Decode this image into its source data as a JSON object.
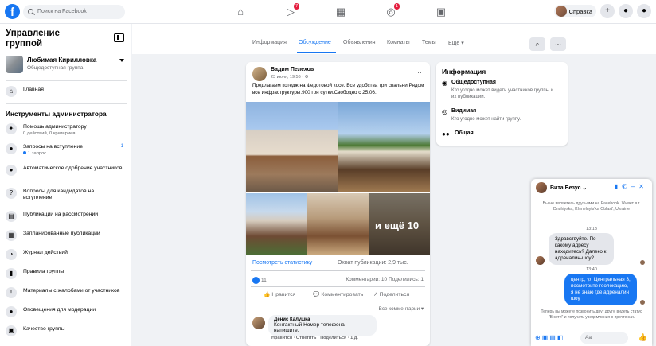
{
  "topbar": {
    "logo": "f",
    "search_placeholder": "Поиск на Facebook",
    "icons": [
      "home-icon",
      "watch-icon",
      "marketplace-icon",
      "groups-icon",
      "gaming-icon"
    ],
    "badges": {
      "watch": "7",
      "groups": "1"
    },
    "profile_label": "Справка",
    "actions": [
      "+",
      "●",
      "●"
    ]
  },
  "sidebar": {
    "title": "Управление группой",
    "group_name": "Любимая Кирилловка",
    "group_privacy": "Общедоступная группа",
    "home_label": "Главная",
    "admin_tools_heading": "Инструменты администратора",
    "items": [
      {
        "label": "Помощь администратору",
        "sub": "0 действий, 0 критериев"
      },
      {
        "label": "Запросы на вступление",
        "sub": "1 запрос",
        "count": "1"
      },
      {
        "label": "Автоматическое одобрение участников",
        "sub": ""
      },
      {
        "label": "Вопросы для кандидатов на вступление",
        "sub": ""
      },
      {
        "label": "Публикации на рассмотрении",
        "sub": ""
      },
      {
        "label": "Запланированные публикации",
        "sub": ""
      },
      {
        "label": "Журнал действий",
        "sub": ""
      },
      {
        "label": "Правила группы",
        "sub": ""
      },
      {
        "label": "Материалы с жалобами от участников",
        "sub": ""
      },
      {
        "label": "Оповещения для модерации",
        "sub": ""
      },
      {
        "label": "Качество группы",
        "sub": ""
      }
    ]
  },
  "tabs": {
    "items": [
      "Информация",
      "Обсуждение",
      "Объявления",
      "Комнаты",
      "Темы",
      "Ещё ▾"
    ],
    "active_index": 1
  },
  "post": {
    "author": "Вадим Пелехов",
    "date": "23 июня, 19:56 · ⚙",
    "text": "Предлагаем котедж на Федотовой косе. Все удобства три спальни.Рядом все инфраструктуры.900 грн сутки.Свободно с 25.06.",
    "more_photos": "и ещё 10",
    "stats_link": "Посмотреть статистику",
    "reach": "Охват публикации: 2,9 тыс.",
    "likes": "11",
    "comments_shares": "Комментарии: 10  Поделились: 1",
    "actions": [
      "Нравится",
      "Комментировать",
      "Поделиться"
    ],
    "all_comments": "Все комментарии ▾",
    "comment": {
      "author": "Денис Калушка",
      "text": "Контактный Номер телефона напишите.",
      "actions": "Нравится · Ответить · Поделиться · 1 д."
    }
  },
  "info": {
    "heading": "Информация",
    "items": [
      {
        "title": "Общедоступная",
        "desc": "Кто угодно может видеть участников группы и их публикации."
      },
      {
        "title": "Видимая",
        "desc": "Кто угодно может найти группу."
      },
      {
        "title": "Общая",
        "desc": ""
      }
    ]
  },
  "chat": {
    "name": "Вита Безус ⌄",
    "info_text": "Вы не являетесь друзьями на Facebook. Живет в г. Dnuhiyska, Khmelnyts'ka Oblast', Ukraine",
    "time1": "13:13",
    "incoming": "Здравствуйте. По какому адресу находитесь? Далеко к адреналин-шоу?",
    "time2": "13:40",
    "outgoing": "центр, ул Центральная 3, посмотрите геолокацию, я не знаю где адреналин шоу",
    "note": "Теперь вы можете позвонить друг другу, видеть статус \"В сети\" и получать уведомления о прочтении.",
    "input_placeholder": "Аа"
  },
  "colors": {
    "accent": "#1877f2",
    "badge": "#e41e3f",
    "bg": "#f0f2f5"
  }
}
